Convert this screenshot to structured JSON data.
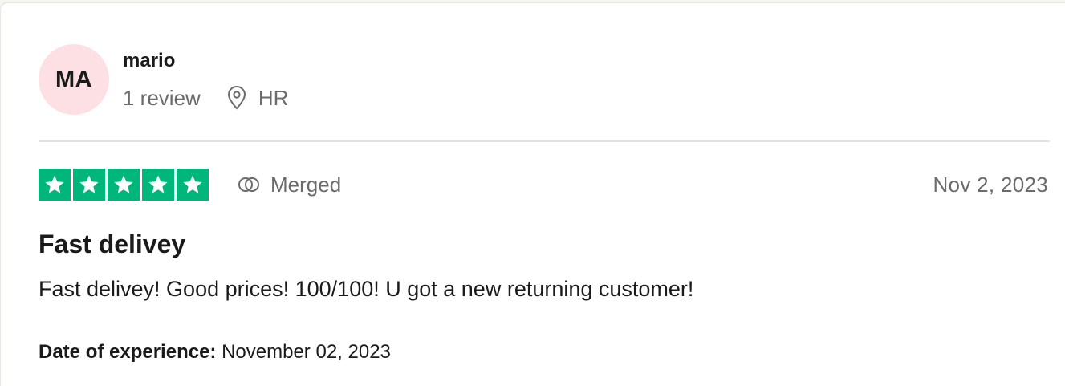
{
  "reviewer": {
    "initials": "MA",
    "name": "mario",
    "review_count": "1 review",
    "location_icon": "location-pin-icon",
    "country": "HR",
    "avatar_color": "#fde0e3"
  },
  "review": {
    "rating": 5,
    "rating_max": 5,
    "star_color": "#00b67a",
    "merged_icon": "merged-icon",
    "merged_label": "Merged",
    "date": "Nov 2, 2023",
    "title": "Fast delivey",
    "body": "Fast delivey! Good prices! 100/100! U got a new returning customer!",
    "experience_label": "Date of experience:",
    "experience_date": "November 02, 2023"
  }
}
